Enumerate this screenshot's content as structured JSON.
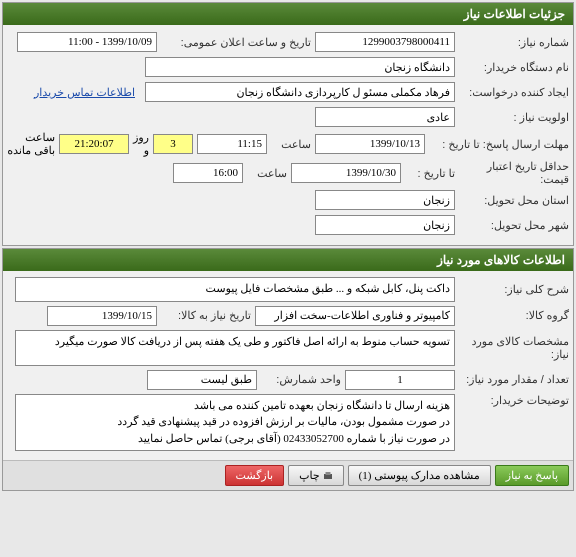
{
  "panel1": {
    "title": "جزئیات اطلاعات نیاز",
    "labels": {
      "reqNo": "شماره نیاز:",
      "pubDate": "تاریخ و ساعت اعلان عمومی:",
      "buyer": "نام دستگاه خریدار:",
      "creator": "ایجاد کننده درخواست:",
      "priority": "اولویت نیاز :",
      "deadline": "مهلت ارسال پاسخ:  تا تاریخ :",
      "hourLbl": "ساعت",
      "dayLbl": "روز و",
      "remainLbl": "ساعت باقی مانده",
      "validUntil": "حداقل تاریخ اعتبار قیمت:",
      "toDate": "تا تاریخ :",
      "province": "استان محل تحویل:",
      "city": "شهر محل تحویل:",
      "contactLink": "اطلاعات تماس خریدار"
    },
    "values": {
      "reqNo": "1299003798000411",
      "pubDate": "1399/10/09 - 11:00",
      "buyer": "دانشگاه زنجان",
      "creator": "فرهاد مکملی مسئو ل کارپردازی دانشگاه زنجان",
      "priority": "عادی",
      "deadlineDate": "1399/10/13",
      "deadlineTime": "11:15",
      "remainDays": "3",
      "remainTime": "21:20:07",
      "validDate": "1399/10/30",
      "validTime": "16:00",
      "province": "زنجان",
      "city": "زنجان"
    }
  },
  "panel2": {
    "title": "اطلاعات کالاهای مورد نیاز",
    "labels": {
      "desc": "شرح کلی نیاز:",
      "group": "گروه کالا:",
      "needDate": "تاریخ نیاز به کالا:",
      "spec": "مشخصات کالای مورد نیاز:",
      "qty": "تعداد / مقدار مورد نیاز:",
      "unit": "واحد شمارش:",
      "buyerDesc": "توضیحات خریدار:"
    },
    "values": {
      "desc": "داکت پنل، کابل شبکه و ... طبق مشخصات فایل پیوست",
      "group": "کامپیوتر و فناوری اطلاعات-سخت افزار",
      "needDate": "1399/10/15",
      "spec": "تسویه حساب منوط به ارائه اصل فاکتور و طی یک هفته پس از دریافت کالا صورت میگیرد",
      "qty": "1",
      "unit": "طبق لیست",
      "buyerDesc": "هزینه ارسال تا دانشگاه زنجان بعهده تامین کننده می باشد\nدر صورت مشمول بودن، مالیات بر ارزش افزوده در قید پیشنهادی قید گردد\nدر صورت نیاز با شماره 02433052700 (آقای برجی) تماس حاصل نمایید"
    }
  },
  "buttons": {
    "respond": "پاسخ به نیاز",
    "attach": "مشاهده مدارک پیوستی (1)",
    "print": "چاپ",
    "back": "بازگشت"
  }
}
